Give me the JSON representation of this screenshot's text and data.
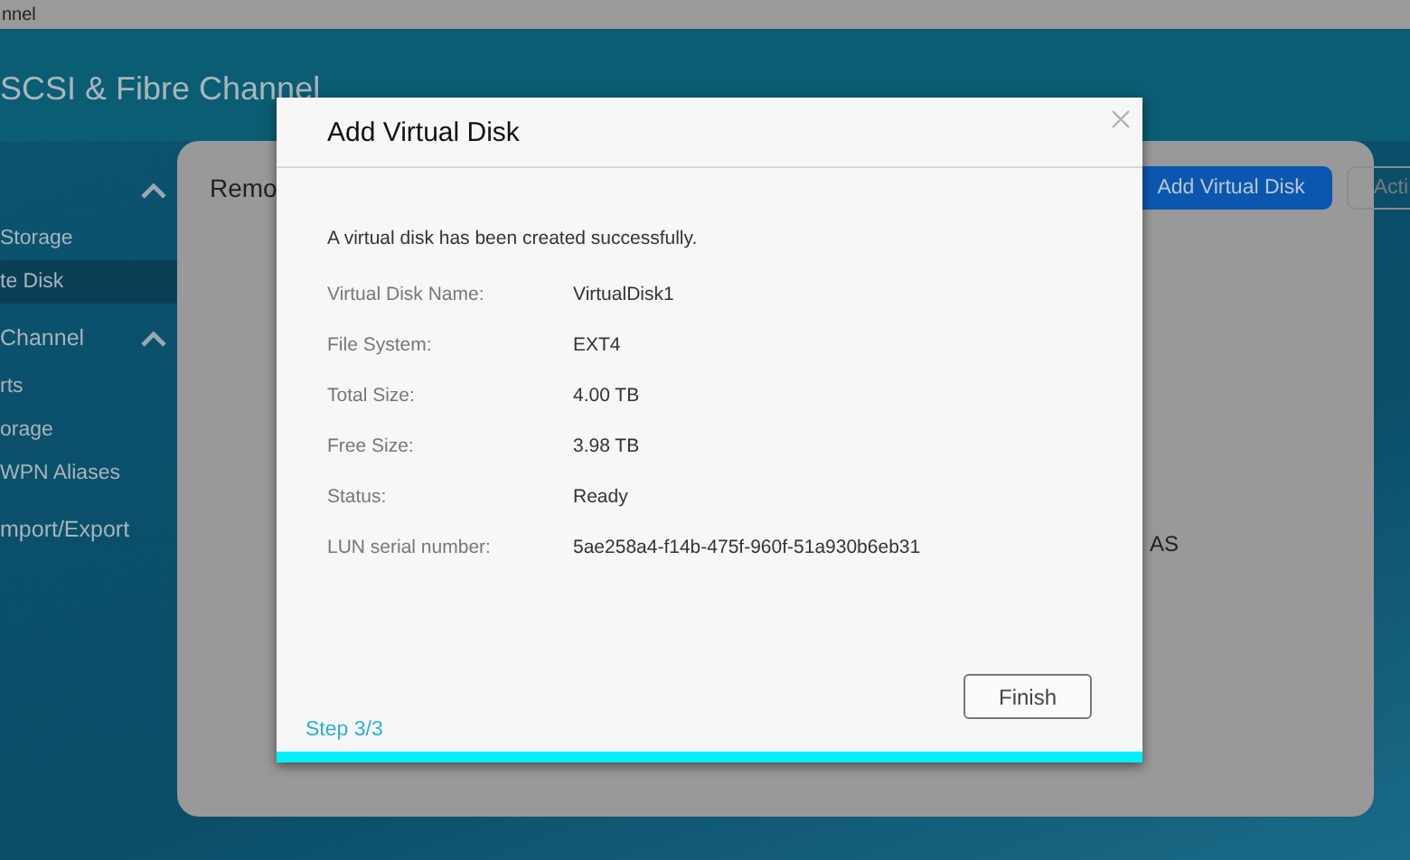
{
  "window": {
    "title": "nnel"
  },
  "header": {
    "title": "SCSI & Fibre Channel"
  },
  "sidebar": {
    "sections": [
      {
        "expanded": true,
        "items": [
          {
            "label": "Storage",
            "selected": false
          },
          {
            "label": "te Disk",
            "selected": true
          }
        ]
      },
      {
        "title": "Channel",
        "expanded": true,
        "items": [
          {
            "label": "rts",
            "selected": false
          },
          {
            "label": "orage",
            "selected": false
          },
          {
            "label": "WPN Aliases",
            "selected": false
          }
        ]
      },
      {
        "title": "mport/Export"
      }
    ]
  },
  "panel": {
    "title": "Remo",
    "buttons": [
      {
        "label": "Add Virtual Disk",
        "kind": "primary"
      },
      {
        "label": "Acti",
        "kind": "outline"
      }
    ],
    "fragment": "AS"
  },
  "dialog": {
    "title": "Add Virtual Disk",
    "message": "A virtual disk has been created successfully.",
    "fields": [
      {
        "label": "Virtual Disk Name:",
        "value": "VirtualDisk1"
      },
      {
        "label": "File System:",
        "value": "EXT4"
      },
      {
        "label": "Total Size:",
        "value": "4.00 TB"
      },
      {
        "label": "Free Size:",
        "value": "3.98 TB"
      },
      {
        "label": "Status:",
        "value": "Ready"
      },
      {
        "label": "LUN serial number:",
        "value": "5ae258a4-f14b-475f-960f-51a930b6eb31"
      }
    ],
    "step": "Step 3/3",
    "finish": "Finish",
    "progress": {
      "level": 1
    }
  }
}
